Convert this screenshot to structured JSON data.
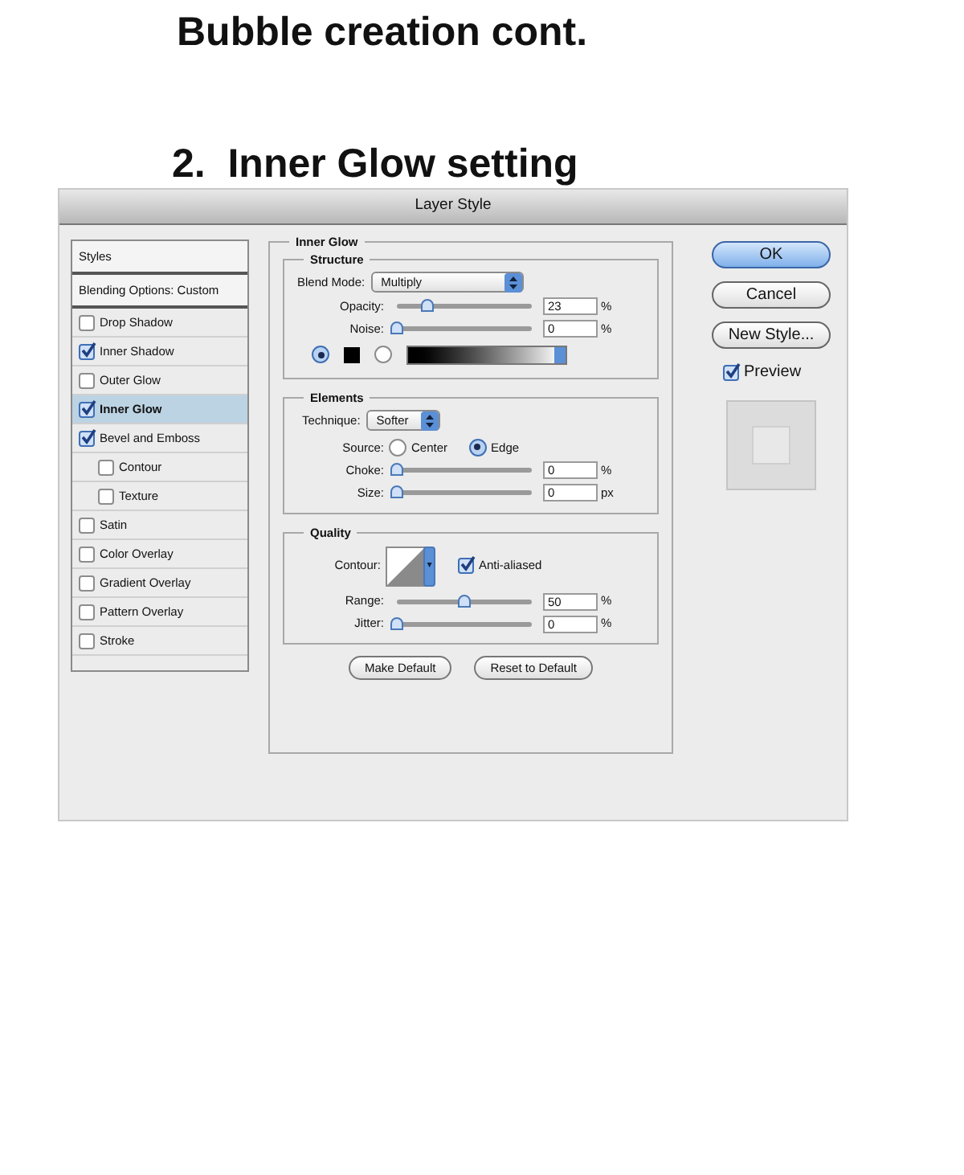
{
  "page_title": "Bubble creation cont.",
  "step_title": "2.  Inner Glow setting",
  "dialog": {
    "title": "Layer Style",
    "styles_list": [
      {
        "kind": "header",
        "label": "Styles",
        "selected": false
      },
      {
        "kind": "header",
        "label": "Blending Options: Custom",
        "selected": false
      },
      {
        "kind": "effect",
        "label": "Drop Shadow",
        "checked": false,
        "selected": false
      },
      {
        "kind": "effect",
        "label": "Inner Shadow",
        "checked": true,
        "selected": false
      },
      {
        "kind": "effect",
        "label": "Outer Glow",
        "checked": false,
        "selected": false
      },
      {
        "kind": "effect",
        "label": "Inner Glow",
        "checked": true,
        "selected": true
      },
      {
        "kind": "effect",
        "label": "Bevel and Emboss",
        "checked": true,
        "selected": false,
        "children": [
          {
            "label": "Contour",
            "checked": false,
            "selected": false
          },
          {
            "label": "Texture",
            "checked": false,
            "selected": false
          }
        ]
      },
      {
        "kind": "effect",
        "label": "Satin",
        "checked": false,
        "selected": false
      },
      {
        "kind": "effect",
        "label": "Color Overlay",
        "checked": false,
        "selected": false
      },
      {
        "kind": "effect",
        "label": "Gradient Overlay",
        "checked": false,
        "selected": false
      },
      {
        "kind": "effect",
        "label": "Pattern Overlay",
        "checked": false,
        "selected": false
      },
      {
        "kind": "effect",
        "label": "Stroke",
        "checked": false,
        "selected": false
      }
    ],
    "panel": {
      "title": "Inner Glow",
      "structure": {
        "title": "Structure",
        "blend_mode": {
          "label": "Blend Mode:",
          "value": "Multiply"
        },
        "sliders": [
          {
            "label": "Opacity:",
            "level": 0.23,
            "value": "23",
            "unit": "%"
          },
          {
            "label": "Noise:",
            "level": 0,
            "value": "0",
            "unit": "%"
          }
        ],
        "fill_options": [
          {
            "kind": "color",
            "selected": true
          },
          {
            "kind": "gradient",
            "selected": false
          }
        ]
      },
      "elements": {
        "title": "Elements",
        "technique": {
          "label": "Technique:",
          "value": "Softer"
        },
        "source": {
          "label": "Source:",
          "options": [
            {
              "label": "Center",
              "selected": false
            },
            {
              "label": "Edge",
              "selected": true
            }
          ]
        },
        "sliders": [
          {
            "label": "Choke:",
            "level": 0,
            "value": "0",
            "unit": "%"
          },
          {
            "label": "Size:",
            "level": 0,
            "value": "0",
            "unit": "px"
          }
        ]
      },
      "quality": {
        "title": "Quality",
        "contour_label": "Contour:",
        "anti_aliased": {
          "label": "Anti-aliased",
          "checked": true
        },
        "sliders": [
          {
            "label": "Range:",
            "level": 0.5,
            "value": "50",
            "unit": "%"
          },
          {
            "label": "Jitter:",
            "level": 0,
            "value": "0",
            "unit": "%"
          }
        ]
      },
      "buttons": [
        "Make Default",
        "Reset to Default"
      ]
    },
    "side_buttons": [
      {
        "label": "OK",
        "kind": "default"
      },
      {
        "label": "Cancel",
        "kind": "normal"
      },
      {
        "label": "New Style...",
        "kind": "normal"
      }
    ],
    "preview": {
      "label": "Preview",
      "checked": true
    }
  }
}
